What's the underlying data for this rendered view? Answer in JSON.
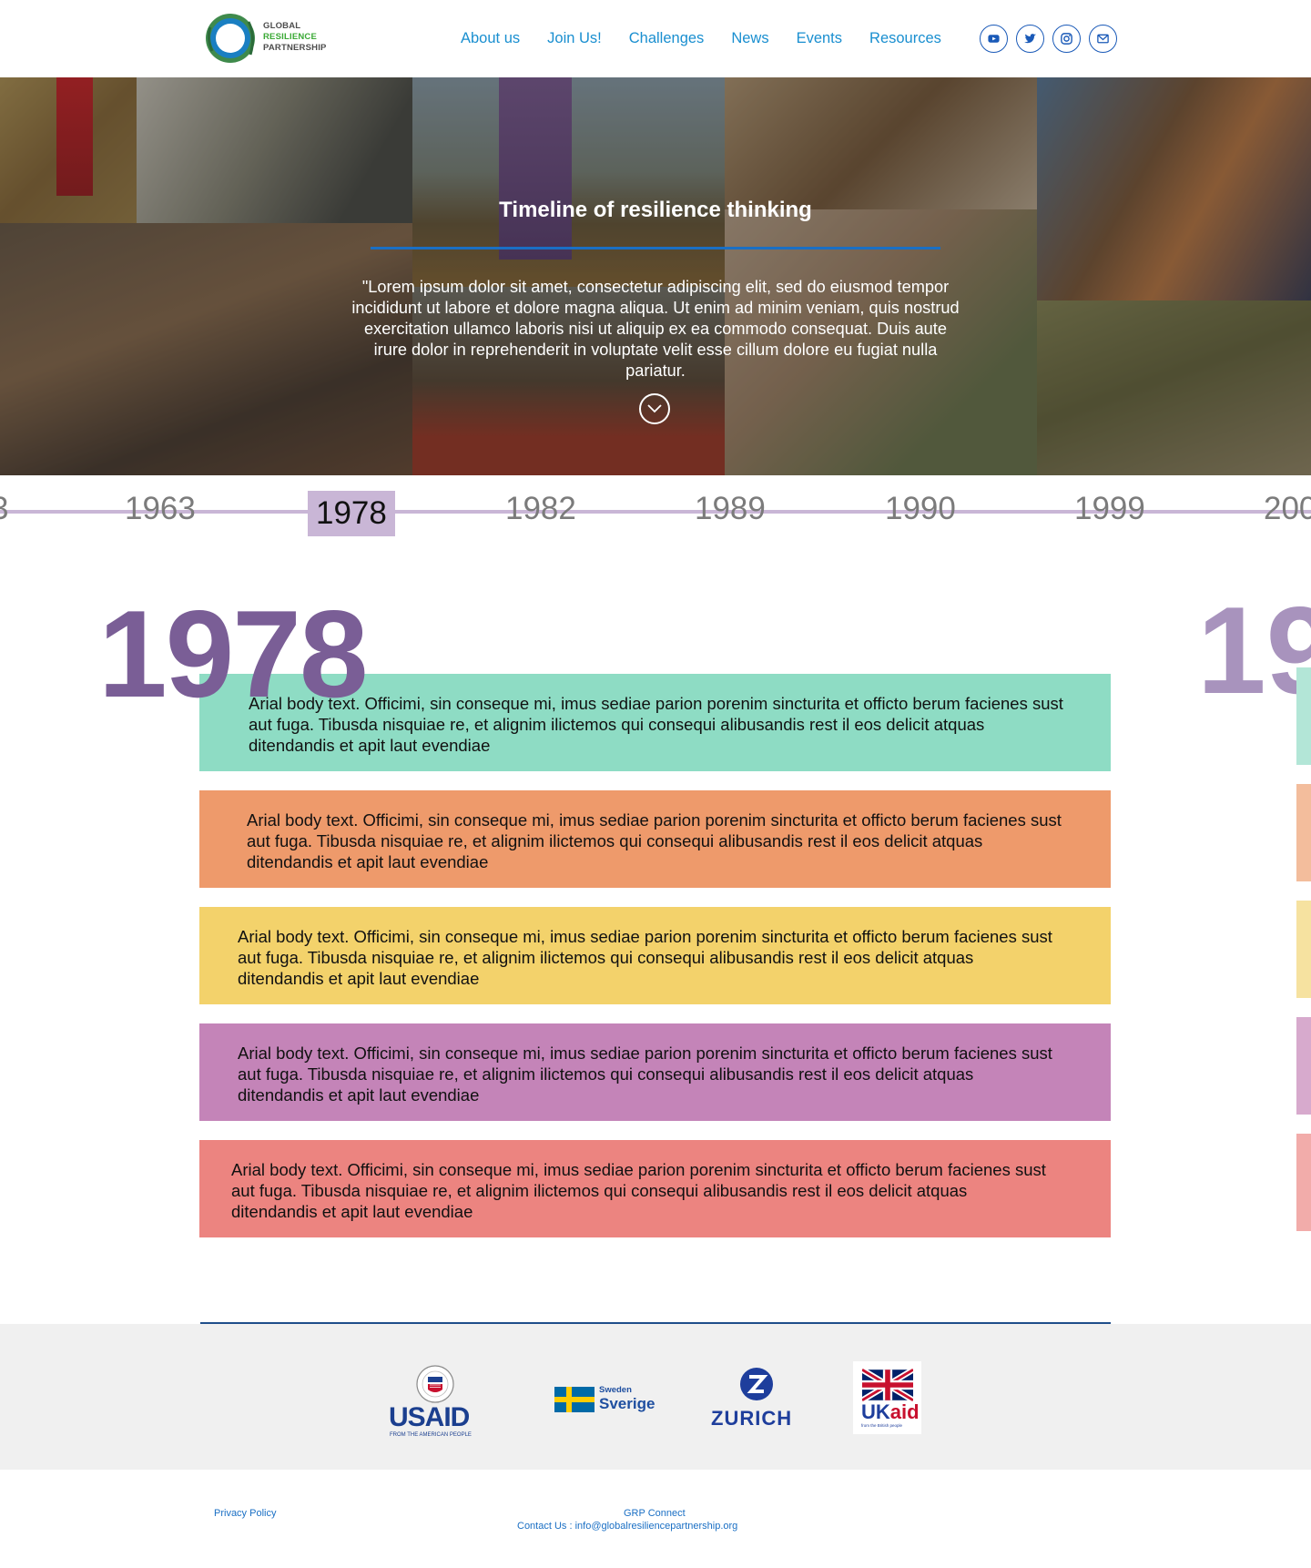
{
  "brand": {
    "logo_line1": "GLOBAL",
    "logo_line2": "RESILIENCE",
    "logo_line3": "PARTNERSHIP"
  },
  "nav": {
    "items": [
      "About us",
      "Join Us!",
      "Challenges",
      "News",
      "Events",
      "Resources"
    ]
  },
  "social": [
    "youtube-icon",
    "twitter-icon",
    "instagram-icon",
    "email-icon"
  ],
  "hero": {
    "title": "Timeline of resilience thinking",
    "quote": "\"Lorem ipsum dolor sit amet, consectetur adipiscing elit, sed do eiusmod tempor incididunt ut labore et dolore magna aliqua. Ut enim ad minim veniam, quis nostrud exercitation ullamco laboris nisi ut aliquip ex ea commodo consequat. Duis aute irure dolor in reprehenderit in voluptate velit esse cillum dolore eu fugiat nulla pariatur."
  },
  "timeline": {
    "years": [
      "3",
      "1963",
      "1978",
      "1982",
      "1989",
      "1990",
      "1999",
      "200"
    ],
    "active": "1978"
  },
  "main": {
    "year": "1978",
    "next_year": "19",
    "cards": [
      {
        "text": "Arial body text. Officimi, sin conseque mi, imus sediae parion porenim sincturita et officto berum facienes sust aut fuga. Tibusda nisquiae re, et alignim ilictemos qui consequi alibusandis rest il eos delicit atquas ditendandis et apit laut evendiae",
        "color": "#8edcc4"
      },
      {
        "text": "Arial body text. Officimi, sin conseque mi, imus sediae parion porenim sincturita et officto berum facienes sust aut fuga. Tibusda nisquiae re, et alignim ilictemos qui consequi alibusandis rest il eos delicit atquas ditendandis et apit laut evendiae",
        "color": "#ee9a6b"
      },
      {
        "text": "Arial body text. Officimi, sin conseque mi, imus sediae parion porenim sincturita et officto berum facienes sust aut fuga. Tibusda nisquiae re, et alignim ilictemos qui consequi alibusandis rest il eos delicit atquas ditendandis et apit laut evendiae",
        "color": "#f3d26b"
      },
      {
        "text": "Arial body text. Officimi, sin conseque mi, imus sediae parion porenim sincturita et officto berum facienes sust aut fuga. Tibusda nisquiae re, et alignim ilictemos qui consequi alibusandis rest il eos delicit atquas ditendandis et apit laut evendiae",
        "color": "#c484b8"
      },
      {
        "text": "Arial body text. Officimi, sin conseque mi, imus sediae parion porenim sincturita et officto berum facienes sust aut fuga. Tibusda nisquiae re, et alignim ilictemos qui consequi alibusandis rest il eos delicit atquas ditendandis et apit laut evendiae",
        "color": "#ec8480"
      }
    ]
  },
  "sponsors": {
    "usaid": "USAID",
    "usaid_sub": "FROM THE AMERICAN PEOPLE",
    "sweden_small": "Sweden",
    "sweden_big": "Sverige",
    "zurich": "ZURICH",
    "ukaid_uk": "UK",
    "ukaid_aid": "aid",
    "ukaid_sub": "from the British people"
  },
  "footer": {
    "privacy": "Privacy Policy",
    "connect": "GRP Connect",
    "contact": "Contact Us : info@globalresiliencepartnership.org"
  }
}
